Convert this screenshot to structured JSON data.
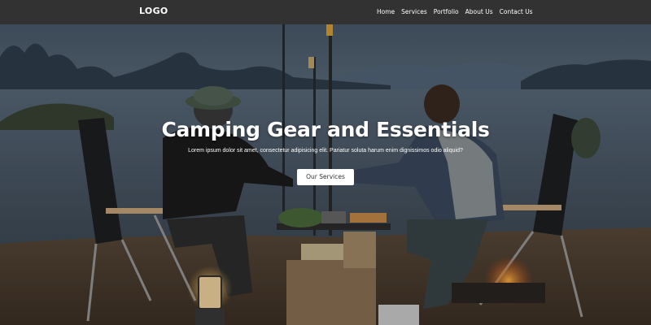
{
  "nav": {
    "logo": "LOGO",
    "links": [
      "Home",
      "Services",
      "Portfolio",
      "About Us",
      "Contact Us"
    ]
  },
  "hero": {
    "title": "Camping Gear and Essentials",
    "subtitle": "Lorem ipsum dolor sit amet, consectetur adipisicing elit. Pariatur soluta harum enim dignissimos odio aliquid?",
    "cta_label": "Our Services"
  },
  "colors": {
    "navbar": "#323232",
    "text": "#ffffff",
    "button_bg": "#ffffff",
    "button_text": "#333333"
  }
}
